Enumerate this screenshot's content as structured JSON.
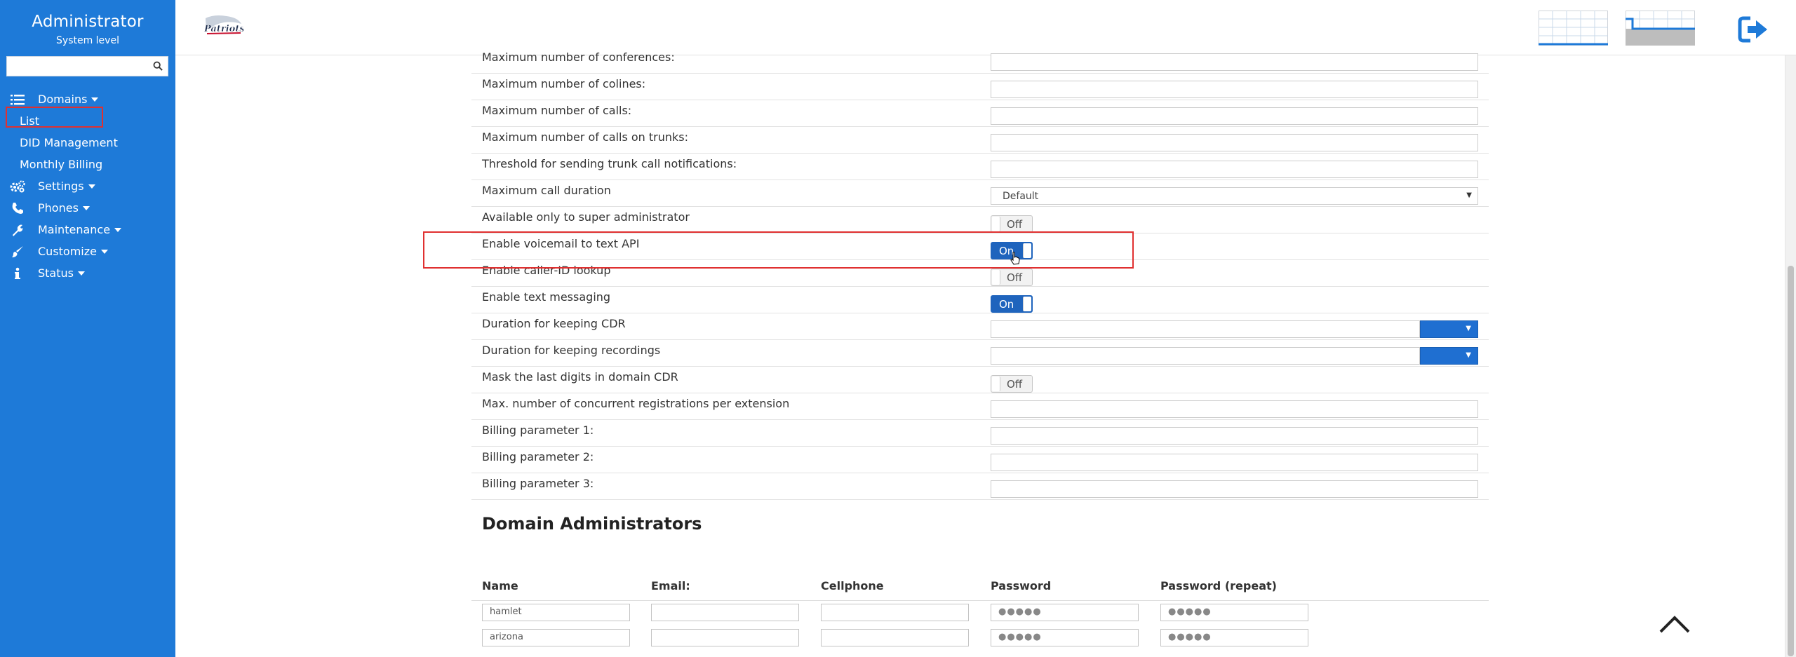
{
  "sidebar": {
    "title": "Administrator",
    "subtitle": "System level",
    "search_placeholder": "",
    "items": [
      {
        "label": "Domains",
        "icon": "list-icon"
      },
      {
        "label": "List"
      },
      {
        "label": "DID Management"
      },
      {
        "label": "Monthly Billing"
      },
      {
        "label": "Settings",
        "icon": "gears-icon"
      },
      {
        "label": "Phones",
        "icon": "phone-icon"
      },
      {
        "label": "Maintenance",
        "icon": "wrench-icon"
      },
      {
        "label": "Customize",
        "icon": "brush-icon"
      },
      {
        "label": "Status",
        "icon": "info-icon"
      }
    ]
  },
  "header": {
    "logo": "Patriots",
    "icons": [
      "layout-grid-icon",
      "layout-step-icon",
      "logout-icon"
    ]
  },
  "form": {
    "rows": [
      {
        "label": "Maximum number of conferences:",
        "type": "text",
        "value": ""
      },
      {
        "label": "Maximum number of colines:",
        "type": "text",
        "value": ""
      },
      {
        "label": "Maximum number of calls:",
        "type": "text",
        "value": ""
      },
      {
        "label": "Maximum number of calls on trunks:",
        "type": "text",
        "value": ""
      },
      {
        "label": "Threshold for sending trunk call notifications:",
        "type": "text",
        "value": ""
      },
      {
        "label": "Maximum call duration",
        "type": "select",
        "value": "Default"
      },
      {
        "label": "Available only to super administrator",
        "type": "toggle",
        "value": "Off"
      },
      {
        "label": "Enable voicemail to text API",
        "type": "toggle",
        "value": "On"
      },
      {
        "label": "Enable caller-ID lookup",
        "type": "toggle",
        "value": "Off"
      },
      {
        "label": "Enable text messaging",
        "type": "toggle",
        "value": "On"
      },
      {
        "label": "Duration for keeping CDR",
        "type": "split",
        "value": ""
      },
      {
        "label": "Duration for keeping recordings",
        "type": "split",
        "value": ""
      },
      {
        "label": "Mask the last digits in domain CDR",
        "type": "toggle",
        "value": "Off"
      },
      {
        "label": "Max. number of concurrent registrations per extension",
        "type": "text",
        "value": ""
      },
      {
        "label": "Billing parameter 1:",
        "type": "text",
        "value": ""
      },
      {
        "label": "Billing parameter 2:",
        "type": "text",
        "value": ""
      },
      {
        "label": "Billing parameter 3:",
        "type": "text",
        "value": ""
      }
    ]
  },
  "domain_admins": {
    "title": "Domain Administrators",
    "columns": [
      "Name",
      "Email:",
      "Cellphone",
      "Password",
      "Password (repeat)"
    ],
    "rows": [
      {
        "name": "hamlet",
        "email": "",
        "cellphone": "",
        "password": "●●●●●",
        "password_repeat": "●●●●●"
      },
      {
        "name": "arizona",
        "email": "",
        "cellphone": "",
        "password": "●●●●●",
        "password_repeat": "●●●●●"
      }
    ]
  },
  "colors": {
    "sidebar_bg": "#1e7ad8",
    "toggle_on": "#1f64bd",
    "highlight": "#e03030"
  }
}
